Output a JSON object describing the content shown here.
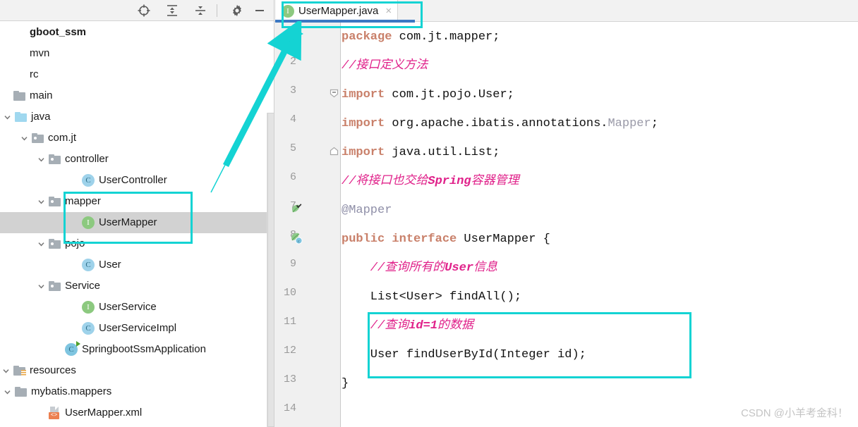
{
  "sidebar": {
    "toolbar": {
      "locate_icon": "crosshair-locate-icon",
      "expand_icon": "expand-all-icon",
      "collapse_icon": "collapse-all-icon",
      "settings_icon": "gear-icon",
      "minimize_icon": "minimize-icon"
    },
    "items": [
      {
        "label": "gboot_ssm",
        "icon": "project-root",
        "indent": 0,
        "chevron": "",
        "bold": true,
        "selected": false
      },
      {
        "label": "mvn",
        "icon": "none",
        "indent": 0,
        "chevron": "",
        "bold": false,
        "selected": false
      },
      {
        "label": "rc",
        "icon": "none",
        "indent": 0,
        "chevron": "",
        "bold": false,
        "selected": false
      },
      {
        "label": "main",
        "icon": "folder-plain",
        "indent": 0,
        "chevron": "",
        "bold": false,
        "selected": false
      },
      {
        "label": "java",
        "icon": "folder-source",
        "indent": 1,
        "chevron": "down",
        "bold": false,
        "selected": false
      },
      {
        "label": "com.jt",
        "icon": "folder-pkg",
        "indent": 2,
        "chevron": "down",
        "bold": false,
        "selected": false
      },
      {
        "label": "controller",
        "icon": "folder-pkg",
        "indent": 3,
        "chevron": "down",
        "bold": false,
        "selected": false
      },
      {
        "label": "UserController",
        "icon": "class",
        "indent": 5,
        "chevron": "",
        "bold": false,
        "selected": false
      },
      {
        "label": "mapper",
        "icon": "folder-pkg",
        "indent": 3,
        "chevron": "down",
        "bold": false,
        "selected": false
      },
      {
        "label": "UserMapper",
        "icon": "interface",
        "indent": 5,
        "chevron": "",
        "bold": false,
        "selected": true
      },
      {
        "label": "pojo",
        "icon": "folder-pkg",
        "indent": 3,
        "chevron": "down",
        "bold": false,
        "selected": false
      },
      {
        "label": "User",
        "icon": "class",
        "indent": 5,
        "chevron": "",
        "bold": false,
        "selected": false
      },
      {
        "label": "Service",
        "icon": "folder-pkg",
        "indent": 3,
        "chevron": "down",
        "bold": false,
        "selected": false
      },
      {
        "label": "UserService",
        "icon": "interface",
        "indent": 5,
        "chevron": "",
        "bold": false,
        "selected": false
      },
      {
        "label": "UserServiceImpl",
        "icon": "class",
        "indent": 5,
        "chevron": "",
        "bold": false,
        "selected": false
      },
      {
        "label": "SpringbootSsmApplication",
        "icon": "runnable-class",
        "indent": 4,
        "chevron": "",
        "bold": false,
        "selected": false
      },
      {
        "label": "resources",
        "icon": "folder-res",
        "indent": 0,
        "chevron": "down",
        "bold": false,
        "selected": false
      },
      {
        "label": "mybatis.mappers",
        "icon": "folder-plain",
        "indent": 1,
        "chevron": "down",
        "bold": false,
        "selected": false
      },
      {
        "label": "UserMapper.xml",
        "icon": "xml-file",
        "indent": 3,
        "chevron": "",
        "bold": false,
        "selected": false
      }
    ]
  },
  "editor": {
    "tab": {
      "label": "UserMapper.java",
      "type_icon": "interface-icon",
      "type_letter": "I",
      "close_icon": "close-icon",
      "close_glyph": "×"
    },
    "line_numbers": [
      "1",
      "2",
      "3",
      "4",
      "5",
      "6",
      "7",
      "8",
      "9",
      "10",
      "11",
      "12",
      "13",
      "14"
    ],
    "gutter_icons": [
      {
        "line": 7,
        "icon": "spring-bean-icon"
      },
      {
        "line": 8,
        "icon": "spring-bean-class-icon"
      }
    ],
    "fold_marks": [
      {
        "line": 3,
        "icon": "fold-collapse-icon"
      },
      {
        "line": 5,
        "icon": "fold-end-icon"
      }
    ],
    "code_lines": [
      {
        "n": 1,
        "segs": [
          {
            "t": "kw",
            "v": "package"
          },
          {
            "t": "plain",
            "v": " com.jt.mapper;"
          }
        ]
      },
      {
        "n": 2,
        "segs": [
          {
            "t": "cmt",
            "v": "//接口定义方法"
          }
        ]
      },
      {
        "n": 3,
        "segs": [
          {
            "t": "kw",
            "v": "import"
          },
          {
            "t": "plain",
            "v": " com.jt.pojo.User;"
          }
        ]
      },
      {
        "n": 4,
        "segs": [
          {
            "t": "kw",
            "v": "import"
          },
          {
            "t": "plain",
            "v": " org.apache.ibatis.annotations."
          },
          {
            "t": "gray",
            "v": "Mapper"
          },
          {
            "t": "plain",
            "v": ";"
          }
        ]
      },
      {
        "n": 5,
        "segs": [
          {
            "t": "kw",
            "v": "import"
          },
          {
            "t": "plain",
            "v": " java.util.List;"
          }
        ]
      },
      {
        "n": 6,
        "segs": [
          {
            "t": "cmt",
            "v": "//将接口也交给"
          },
          {
            "t": "cmtb",
            "v": "Spring"
          },
          {
            "t": "cmt",
            "v": "容器管理"
          }
        ]
      },
      {
        "n": 7,
        "segs": [
          {
            "t": "anno",
            "v": "@Mapper"
          }
        ]
      },
      {
        "n": 8,
        "segs": [
          {
            "t": "kw",
            "v": "public interface"
          },
          {
            "t": "plain",
            "v": " UserMapper {"
          }
        ]
      },
      {
        "n": 9,
        "segs": [
          {
            "t": "cmt",
            "v": "    //查询所有的"
          },
          {
            "t": "cmtb",
            "v": "User"
          },
          {
            "t": "cmt",
            "v": "信息"
          }
        ]
      },
      {
        "n": 10,
        "segs": [
          {
            "t": "plain",
            "v": "    List<User> findAll();"
          }
        ]
      },
      {
        "n": 11,
        "segs": [
          {
            "t": "cmt",
            "v": "    //查询"
          },
          {
            "t": "cmtb",
            "v": "id=1"
          },
          {
            "t": "cmt",
            "v": "的数据"
          }
        ]
      },
      {
        "n": 12,
        "segs": [
          {
            "t": "plain",
            "v": "    User findUserById(Integer id);"
          }
        ]
      },
      {
        "n": 13,
        "segs": [
          {
            "t": "plain",
            "v": "}"
          }
        ]
      },
      {
        "n": 14,
        "segs": []
      }
    ]
  },
  "annotations": {
    "highlight_color": "#14d3d3",
    "boxes": [
      {
        "name": "tab-highlight",
        "target": "UserMapper.java tab"
      },
      {
        "name": "tree-highlight",
        "target": "mapper / UserMapper"
      },
      {
        "name": "code-highlight",
        "target": "lines 11-12"
      }
    ],
    "arrow": {
      "name": "pointer-arrow",
      "from": "tree-highlight",
      "to": "tab-highlight"
    }
  },
  "watermark": {
    "text": "CSDN @小羊考金科！"
  },
  "colors": {
    "accent_blue": "#3b78c3",
    "selection_gray": "#d2d2d2",
    "keyword": "#c9806a",
    "comment": "#e0218a",
    "annotation": "#8f8fa8",
    "grayed_ref": "#9a9aa8",
    "highlight": "#14d3d3"
  }
}
